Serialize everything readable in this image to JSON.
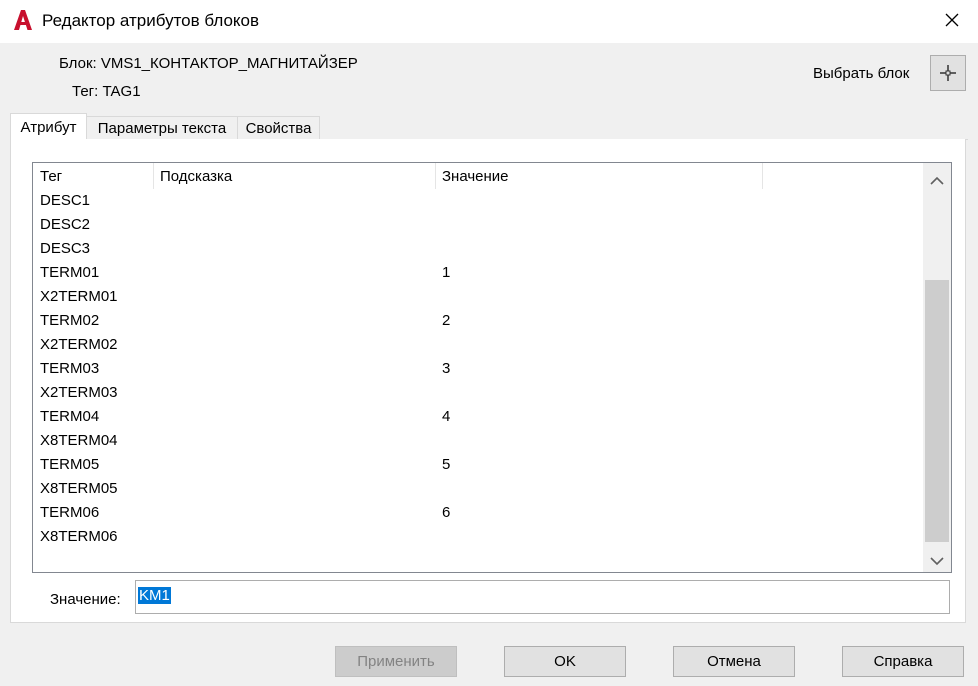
{
  "window": {
    "title": "Редактор атрибутов блоков",
    "app_icon": "autocad-a-icon",
    "accent_color": "#c8102e"
  },
  "header": {
    "block_label": "Блок: VMS1_КОНТАКТОР_МАГНИТАЙЗЕР",
    "tag_label": "Тег: TAG1",
    "select_block_label": "Выбрать блок",
    "select_block_icon": "crosshair-pick-icon"
  },
  "tabs": [
    {
      "label": "Атрибут",
      "active": true
    },
    {
      "label": "Параметры текста",
      "active": false
    },
    {
      "label": "Свойства",
      "active": false
    }
  ],
  "table": {
    "columns": [
      "Тег",
      "Подсказка",
      "Значение"
    ],
    "rows": [
      {
        "tag": "DESC1",
        "prompt": "",
        "value": ""
      },
      {
        "tag": "DESC2",
        "prompt": "",
        "value": ""
      },
      {
        "tag": "DESC3",
        "prompt": "",
        "value": ""
      },
      {
        "tag": "TERM01",
        "prompt": "",
        "value": "1"
      },
      {
        "tag": "X2TERM01",
        "prompt": "",
        "value": ""
      },
      {
        "tag": "TERM02",
        "prompt": "",
        "value": "2"
      },
      {
        "tag": "X2TERM02",
        "prompt": "",
        "value": ""
      },
      {
        "tag": "TERM03",
        "prompt": "",
        "value": "3"
      },
      {
        "tag": "X2TERM03",
        "prompt": "",
        "value": ""
      },
      {
        "tag": "TERM04",
        "prompt": "",
        "value": "4"
      },
      {
        "tag": "X8TERM04",
        "prompt": "",
        "value": ""
      },
      {
        "tag": "TERM05",
        "prompt": "",
        "value": "5"
      },
      {
        "tag": "X8TERM05",
        "prompt": "",
        "value": ""
      },
      {
        "tag": "TERM06",
        "prompt": "",
        "value": "6"
      },
      {
        "tag": "X8TERM06",
        "prompt": "",
        "value": ""
      }
    ]
  },
  "value_field": {
    "label": "Значение:",
    "value": "KM1",
    "selection_color": "#0078d7"
  },
  "buttons": {
    "apply": "Применить",
    "ok": "OK",
    "cancel": "Отмена",
    "help": "Справка"
  }
}
